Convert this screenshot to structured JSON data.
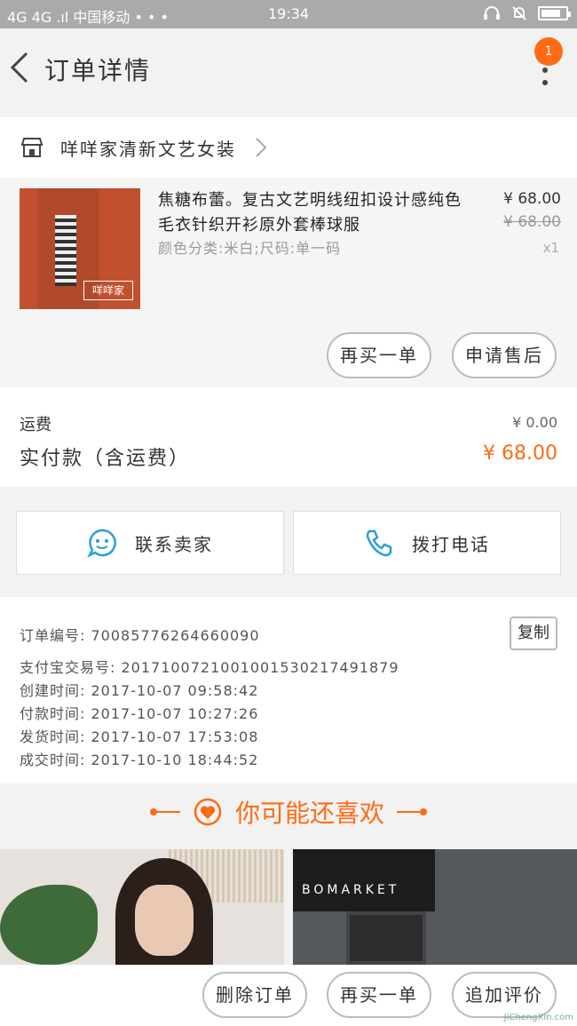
{
  "status_bar": {
    "carrier": "4G 4G .ıl 中国移动 • • •",
    "time": "19:34"
  },
  "nav": {
    "title": "订单详情",
    "badge_count": "1"
  },
  "shop": {
    "name": "咩咩家清新文艺女装"
  },
  "product": {
    "name": "焦糖布蕾。复古文艺明线纽扣设计感纯色毛衣针织开衫原外套棒球服",
    "attrs": "颜色分类:米白;尺码:单一码",
    "price": "¥ 68.00",
    "original_price": "¥ 68.00",
    "quantity": "x1",
    "image_logo": "咩咩家"
  },
  "product_actions": {
    "buy_again": "再买一单",
    "after_sale": "申请售后"
  },
  "fees": {
    "shipping_label": "运费",
    "shipping_value": "¥ 0.00",
    "paid_label": "实付款（含运费）",
    "paid_value": "¥ 68.00"
  },
  "contact": {
    "seller": "联系卖家",
    "call": "拨打电话"
  },
  "order_info": {
    "order_no": "订单编号: 70085776264660090",
    "alipay_no": "支付宝交易号: 2017100721001001530217491879",
    "created": "创建时间: 2017-10-07 09:58:42",
    "paid": "付款时间: 2017-10-07 10:27:26",
    "shipped": "发货时间: 2017-10-07 17:53:08",
    "completed": "成交时间: 2017-10-10 18:44:52",
    "copy": "复制"
  },
  "recommend": {
    "title": "你可能还喜欢",
    "shop_sign": "BOMARKET"
  },
  "bottom_actions": {
    "delete": "删除订单",
    "buy_again": "再买一单",
    "evaluate": "追加评价"
  },
  "watermark": "JiChengXin.com",
  "colors": {
    "accent": "#ff6a13",
    "statusbar": "#aaaaaa",
    "background": "#f2f2f2"
  }
}
